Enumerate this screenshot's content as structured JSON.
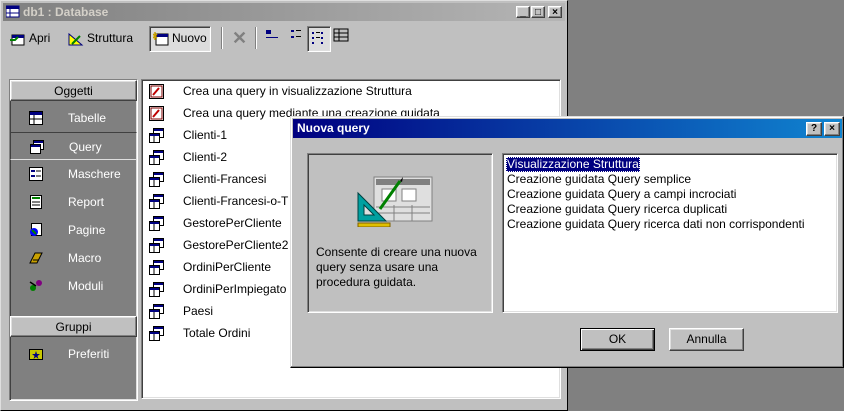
{
  "db_window": {
    "title": "db1 : Database",
    "toolbar": {
      "open": "Apri",
      "design": "Struttura",
      "new": "Nuovo"
    },
    "objects_group": {
      "header": "Oggetti",
      "items": [
        {
          "label": "Tabelle",
          "icon": "table-icon"
        },
        {
          "label": "Query",
          "icon": "query-icon",
          "selected": true
        },
        {
          "label": "Maschere",
          "icon": "form-icon"
        },
        {
          "label": "Report",
          "icon": "report-icon"
        },
        {
          "label": "Pagine",
          "icon": "page-icon"
        },
        {
          "label": "Macro",
          "icon": "macro-icon"
        },
        {
          "label": "Moduli",
          "icon": "module-icon"
        }
      ]
    },
    "groups": {
      "header": "Gruppi",
      "items": [
        {
          "label": "Preferiti",
          "icon": "favorites-icon"
        }
      ]
    },
    "queries": [
      "Crea una query in visualizzazione Struttura",
      "Crea una query mediante una creazione guidata",
      "Clienti-1",
      "Clienti-2",
      "Clienti-Francesi",
      "Clienti-Francesi-o-T",
      "GestorePerCliente",
      "GestorePerCliente2",
      "OrdiniPerCliente",
      "OrdiniPerImpiegato",
      "Paesi",
      "Totale Ordini"
    ]
  },
  "dialog": {
    "title": "Nuova query",
    "description": "Consente di creare una nuova query senza usare una procedura guidata.",
    "options": [
      "Visualizzazione Struttura",
      "Creazione guidata Query semplice",
      "Creazione guidata Query a campi incrociati",
      "Creazione guidata Query ricerca duplicati",
      "Creazione guidata Query ricerca dati non corrispondenti"
    ],
    "selected_option": "Visualizzazione Struttura",
    "ok": "OK",
    "cancel": "Annulla"
  },
  "colors": {
    "active_title": "#000080",
    "inactive_title": "#808080",
    "selection": "#000080"
  }
}
